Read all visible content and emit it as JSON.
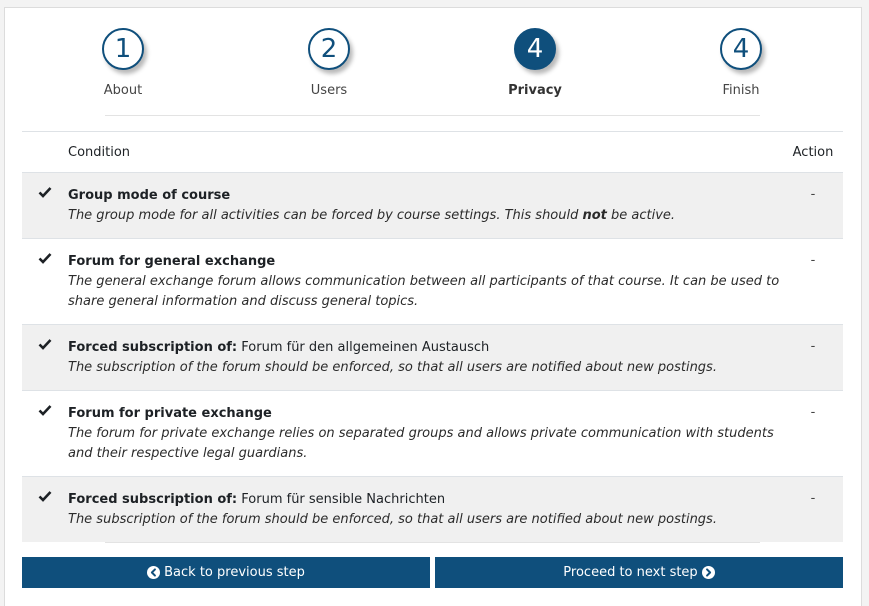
{
  "steps": [
    {
      "number": "1",
      "label": "About",
      "active": false
    },
    {
      "number": "2",
      "label": "Users",
      "active": false
    },
    {
      "number": "4",
      "label": "Privacy",
      "active": true
    },
    {
      "number": "4",
      "label": "Finish",
      "active": false
    }
  ],
  "table": {
    "col_condition": "Condition",
    "col_action": "Action",
    "rows": [
      {
        "title": "Group mode of course",
        "title_suffix": "",
        "desc_before": "The group mode for all activities can be forced by course settings. This should ",
        "desc_bold": "not",
        "desc_after": " be active.",
        "action": "-"
      },
      {
        "title": "Forum for general exchange",
        "title_suffix": "",
        "desc_before": "The general exchange forum allows communication between all participants of that course. It can be used to share general information and discuss general topics.",
        "desc_bold": "",
        "desc_after": "",
        "action": "-"
      },
      {
        "title": "Forced subscription of:",
        "title_suffix": " Forum für den allgemeinen Austausch",
        "desc_before": "The subscription of the forum should be enforced, so that all users are notified about new postings.",
        "desc_bold": "",
        "desc_after": "",
        "action": "-"
      },
      {
        "title": "Forum for private exchange",
        "title_suffix": "",
        "desc_before": "The forum for private exchange relies on separated groups and allows private communication with students and their respective legal guardians.",
        "desc_bold": "",
        "desc_after": "",
        "action": "-"
      },
      {
        "title": "Forced subscription of:",
        "title_suffix": " Forum für sensible Nachrichten",
        "desc_before": "The subscription of the forum should be enforced, so that all users are notified about new postings.",
        "desc_bold": "",
        "desc_after": "",
        "action": "-"
      }
    ]
  },
  "buttons": {
    "back": "Back to previous step",
    "next": "Proceed to next step"
  },
  "colors": {
    "primary": "#0f4f7c",
    "row_stripe": "#f0f0f0"
  },
  "icons": {
    "row_status": "check-icon",
    "back": "chevron-circle-left-icon",
    "next": "chevron-circle-right-icon"
  }
}
